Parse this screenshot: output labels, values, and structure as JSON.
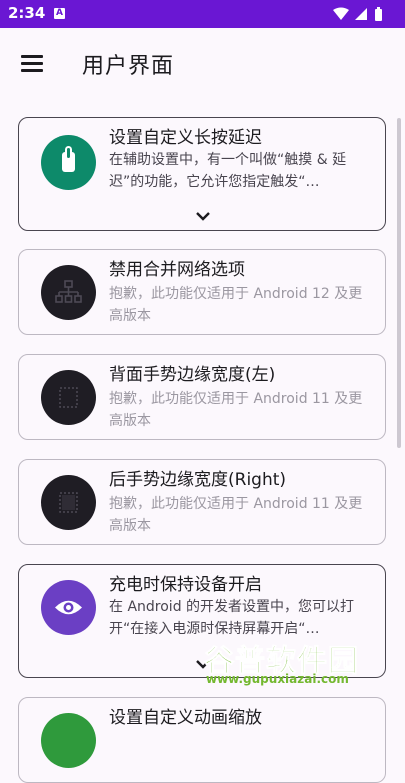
{
  "status_bar": {
    "time": "2:34",
    "notification_glyph": "A",
    "icons": [
      "wifi-icon",
      "signal-icon",
      "battery-icon"
    ]
  },
  "app_bar": {
    "title": "用户界面",
    "menu_icon": "hamburger-menu-icon"
  },
  "cards": [
    {
      "title": "设置自定义长按延迟",
      "desc": "在辅助设置中，有一个叫做“触摸 & 延迟”的功能，它允许您指定触发“…",
      "icon": "touch-hand-icon",
      "color": "#0d8a6a",
      "expanded_indicator": "chevron-down-icon"
    },
    {
      "title": "禁用合并网络选项",
      "desc": "抱歉，此功能仅适用于 Android 12 及更高版本",
      "icon": "network-icon",
      "color": "#1f1d24",
      "disabled": true
    },
    {
      "title": "背面手势边缘宽度(左)",
      "desc": "抱歉，此功能仅适用于 Android 11 及更高版本",
      "icon": "edge-left-icon",
      "color": "#1f1d24",
      "disabled": true
    },
    {
      "title": "后手势边缘宽度(Right)",
      "desc": "抱歉，此功能仅适用于 Android 11 及更高版本",
      "icon": "edge-right-icon",
      "color": "#1f1d24",
      "disabled": true
    },
    {
      "title": "充电时保持设备开启",
      "desc": "在 Android 的开发者设置中，您可以打开“在接入电源时保持屏幕开启“…",
      "icon": "eye-icon",
      "color": "#6b3fc4",
      "expanded_indicator": "chevron-down-icon"
    },
    {
      "title": "设置自定义动画缩放",
      "icon": "animation-icon",
      "color": "#2f9a3c"
    }
  ],
  "watermark": {
    "text": "谷普软件园",
    "url": "www.gupuxiazai.com"
  }
}
